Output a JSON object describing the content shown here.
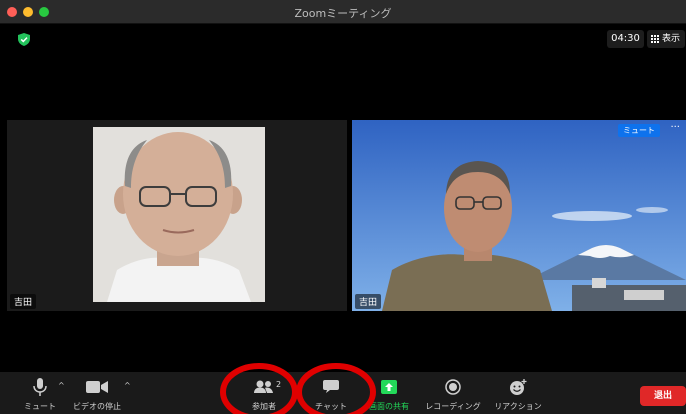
{
  "window": {
    "title": "Zoomミーティング"
  },
  "meeting": {
    "timer": "04:30",
    "view_label": "表示"
  },
  "participants": [
    {
      "name": "吉田"
    },
    {
      "name": "吉田",
      "mute_label": "ミュート",
      "more_label": "···"
    }
  ],
  "toolbar": {
    "mute_label": "ミュート",
    "video_label": "ビデオの停止",
    "participants_label": "参加者",
    "participants_count": "2",
    "chat_label": "チャット",
    "share_label": "画面の共有",
    "record_label": "レコーディング",
    "reactions_label": "リアクション",
    "leave_label": "退出",
    "caret_symbol": "^"
  },
  "colors": {
    "share_green": "#23d959",
    "leave_red": "#e02828",
    "annotation_red": "#e00000",
    "accent_blue": "#0e72ed"
  }
}
